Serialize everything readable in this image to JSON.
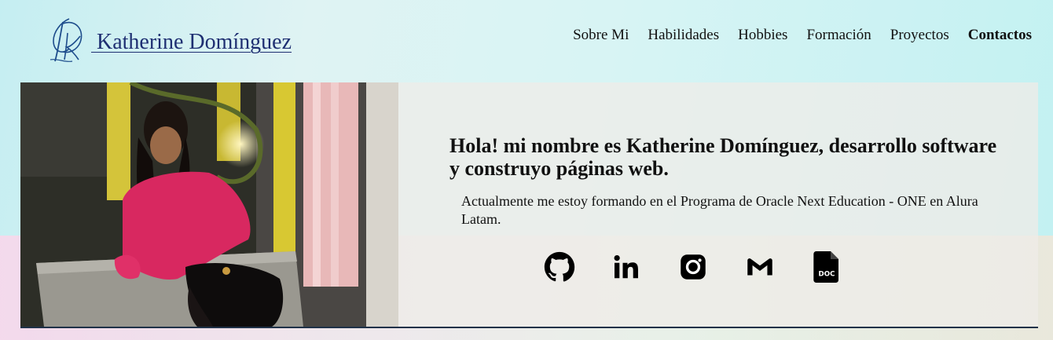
{
  "brand": {
    "name": " Katherine Domínguez",
    "monogram_icon": "kd-monogram-icon"
  },
  "nav": {
    "items": [
      {
        "label": "Sobre Mi",
        "active": false
      },
      {
        "label": "Habilidades",
        "active": false
      },
      {
        "label": "Hobbies",
        "active": false
      },
      {
        "label": "Formación",
        "active": false
      },
      {
        "label": "Proyectos",
        "active": false
      },
      {
        "label": "Contactos",
        "active": true
      }
    ]
  },
  "hero": {
    "photo_icon": "profile-photo",
    "title": "Hola! mi nombre es Katherine Domínguez, desarrollo software y construyo páginas web.",
    "subtitle": "Actualmente me estoy formando en el Programa de Oracle Next Education - ONE en Alura Latam.",
    "socials": [
      {
        "icon": "github-icon"
      },
      {
        "icon": "linkedin-icon"
      },
      {
        "icon": "instagram-icon"
      },
      {
        "icon": "gmail-icon"
      },
      {
        "icon": "doc-icon",
        "label": "DOC"
      }
    ]
  },
  "colors": {
    "brand_text": "#1e2f72",
    "hero_border": "#1f3148"
  }
}
